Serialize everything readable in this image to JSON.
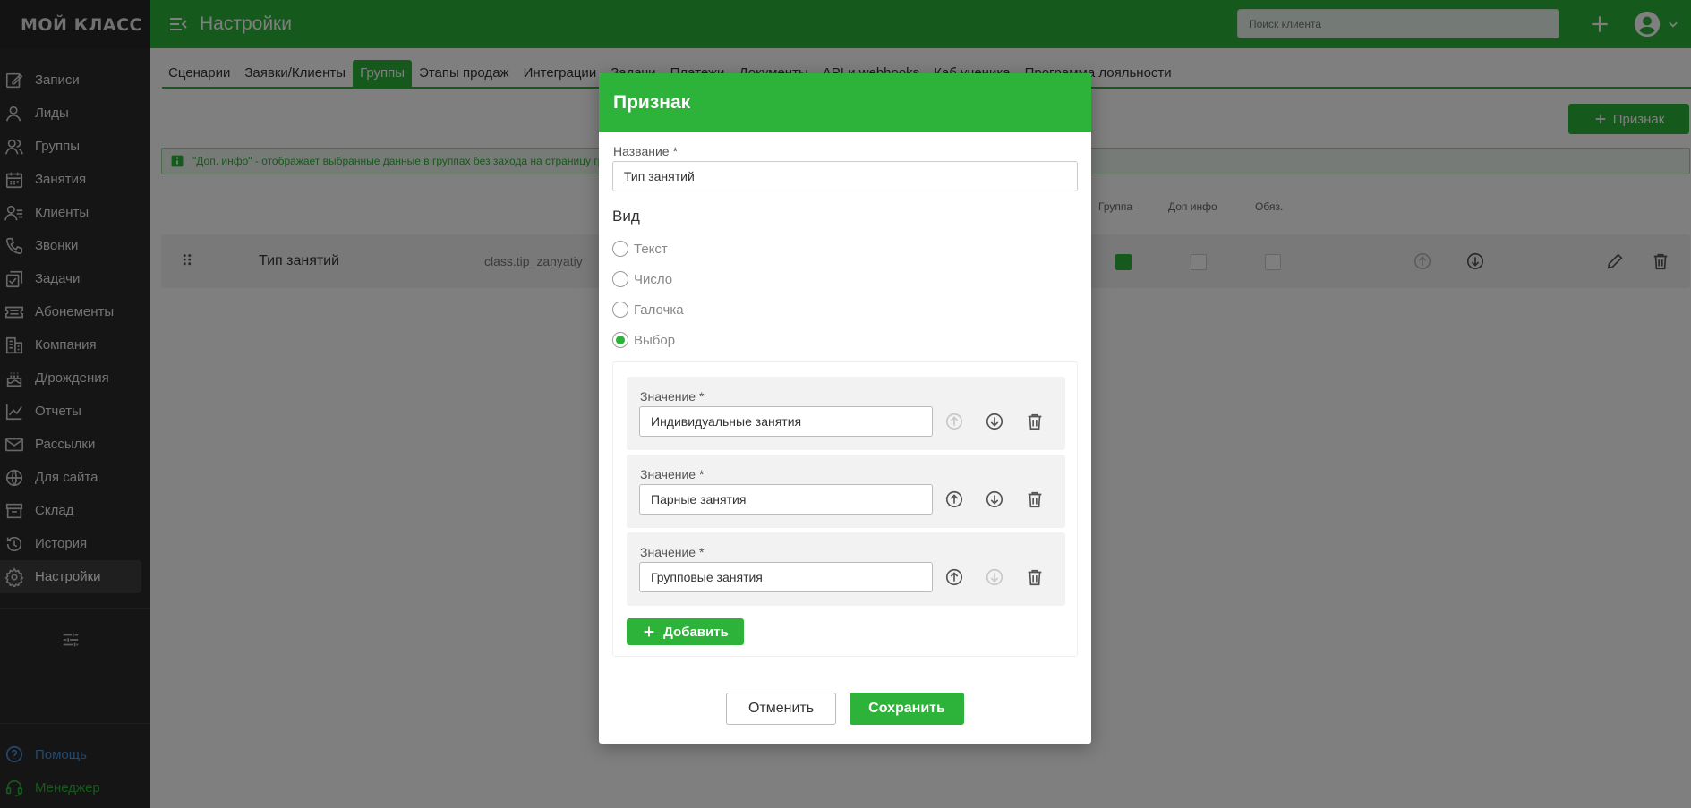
{
  "app": {
    "logo": "МОЙ КЛАСС",
    "page_title": "Настройки"
  },
  "colors": {
    "brand": "#2db339",
    "sidebar": "#2a2a2a",
    "help": "#4a90d9"
  },
  "sidebar": {
    "items": [
      {
        "label": "Записи",
        "icon": "edit-note-icon"
      },
      {
        "label": "Лиды",
        "icon": "person-icon"
      },
      {
        "label": "Группы",
        "icon": "group-icon"
      },
      {
        "label": "Занятия",
        "icon": "calendar-icon"
      },
      {
        "label": "Клиенты",
        "icon": "client-list-icon"
      },
      {
        "label": "Звонки",
        "icon": "phone-icon"
      },
      {
        "label": "Задачи",
        "icon": "tasks-icon"
      },
      {
        "label": "Абонементы",
        "icon": "ticket-icon"
      },
      {
        "label": "Компания",
        "icon": "building-icon"
      },
      {
        "label": "Д/рождения",
        "icon": "cake-icon"
      },
      {
        "label": "Отчеты",
        "icon": "chart-icon"
      },
      {
        "label": "Рассылки",
        "icon": "mail-icon"
      },
      {
        "label": "Для сайта",
        "icon": "globe-icon"
      },
      {
        "label": "Склад",
        "icon": "warehouse-icon"
      },
      {
        "label": "История",
        "icon": "history-icon"
      },
      {
        "label": "Настройки",
        "icon": "gear-icon"
      }
    ],
    "help": "Помощь",
    "manager": "Менеджер"
  },
  "topbar": {
    "search_placeholder": "Поиск клиента"
  },
  "tabs": [
    "Сценарии",
    "Заявки/Клиенты",
    "Группы",
    "Этапы продаж",
    "Интеграции",
    "Задачи",
    "Платежи",
    "Документы",
    "API и webhooks",
    "Каб.ученика",
    "Программа лояльности"
  ],
  "active_tab": "Группы",
  "page": {
    "add_button": "Признак",
    "info_text": "\"Доп. инфо\" - отображает выбранные данные в группах без захода на страницу группы",
    "columns": {
      "group": "Группа",
      "extra": "Доп инфо",
      "required": "Обяз."
    },
    "row": {
      "name": "Тип занятий",
      "code": "class.tip_zanyatiy",
      "group": true,
      "extra": false,
      "required": false
    }
  },
  "modal": {
    "title": "Признак",
    "name_label": "Название *",
    "name_value": "Тип занятий",
    "type_label": "Вид",
    "types": [
      {
        "label": "Текст",
        "selected": false
      },
      {
        "label": "Число",
        "selected": false
      },
      {
        "label": "Галочка",
        "selected": false
      },
      {
        "label": "Выбор",
        "selected": true
      }
    ],
    "value_label": "Значение *",
    "values": [
      "Индивидуальные занятия",
      "Парные занятия",
      "Групповые занятия"
    ],
    "add_button": "Добавить",
    "cancel": "Отменить",
    "save": "Сохранить"
  }
}
